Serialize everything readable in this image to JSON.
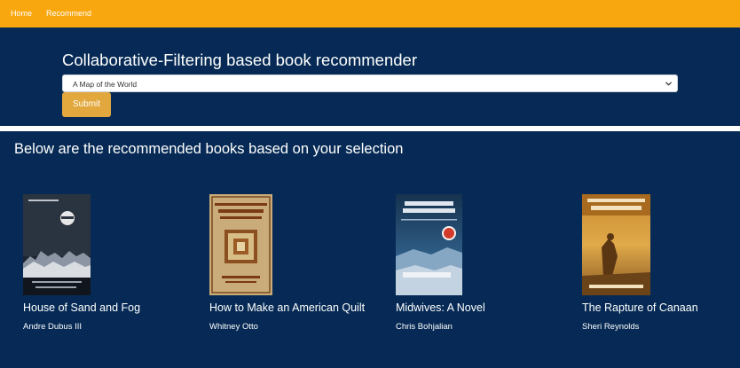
{
  "nav": {
    "home_label": "Home",
    "recommend_label": "Recommend"
  },
  "form": {
    "title": "Collaborative-Filtering based book recommender",
    "selected_book": "A Map of the World",
    "submit_label": "Submit"
  },
  "results": {
    "heading": "Below are the recommended books based on your selection",
    "books": [
      {
        "title": "House of Sand and Fog",
        "author": "Andre Dubus III",
        "cover_label": "",
        "cover_subtitle": ""
      },
      {
        "title": "How to Make an American Quilt",
        "author": "Whitney Otto",
        "cover_label": "AMERICAN QUILT",
        "cover_subtitle": "WHITNEY OTTO"
      },
      {
        "title": "Midwives: A Novel",
        "author": "Chris Bohjalian",
        "cover_label": "CHRIS BOHJALIAN",
        "cover_subtitle": "Midwives"
      },
      {
        "title": "The Rapture of Canaan",
        "author": "Sheri Reynolds",
        "cover_label": "THE RAPTURE OF CANAAN",
        "cover_subtitle": "SHERI REYNOLDS"
      }
    ]
  },
  "colors": {
    "navbar": "#f9a70f",
    "background": "#062a55",
    "submit": "#e2a83e",
    "text": "#ffffff"
  }
}
